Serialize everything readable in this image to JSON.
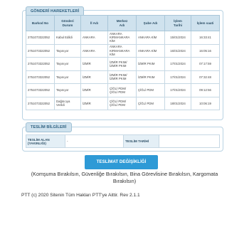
{
  "movements": {
    "title": "GÖNDERİ HAREKETLERİ",
    "headers": [
      "Barkod No",
      "Gönderi\nDurum",
      "İl Adı",
      "Merkez\nAdı",
      "Şube Adı",
      "İşlem\nTarihi",
      "İşlem saati"
    ],
    "rows": [
      [
        "2751073322052",
        "Kabul Edildi",
        "ANKARA",
        "ANKARA KIRMANKARA KİM",
        "ANKARA KİM",
        "15/01/2024",
        "16:33:41"
      ],
      [
        "2751073322052",
        "Taşınıyor",
        "ANKARA",
        "ANKARA KIRMANKARA KİM",
        "ANKARA KİM",
        "16/01/2024",
        "16:05:16"
      ],
      [
        "2751073322052",
        "Taşınıyor",
        "İZMİR",
        "İZMİR PKIM/ İZMİR PKIM",
        "İZMİR PKIM",
        "17/01/2024",
        "07:17:59"
      ],
      [
        "2751073322052",
        "Taşınıyor",
        "İZMİR",
        "İZMİR PKIM/ İZMİR PKIM",
        "İZMİR PKIM",
        "17/01/2024",
        "07:32:48"
      ],
      [
        "2751073322052",
        "Taşınıyor",
        "İZMİR",
        "ÇİĞLİ PDM/ ÇİĞLİ PDM",
        "ÇİĞLİ PDM",
        "17/01/2024",
        "09:12:56"
      ],
      [
        "2751073322052",
        "Dağıtıcıya Verildi",
        "İZMİR",
        "ÇİĞLİ PDM/ ÇİĞLİ PDM",
        "ÇİĞLİ PDM",
        "18/01/2024",
        "10:06:19"
      ]
    ]
  },
  "delivery": {
    "title": "TESLİM BİLGİLERİ",
    "receiver_label": "TESLİM ALAN (YAKINLIĞI)",
    "receiver_value": "-",
    "date_label": "TESLİM TARİHİ",
    "date_value": ""
  },
  "change_button": "TESLİMAT DEĞİŞİKLİĞİ",
  "change_note": "(Komşuma Bırakılsın, Güvenliğe Bırakılsın, Bina Görevlisine Bırakılsın, Kargomata Bırakılsın)",
  "footer": "PTT (c) 2020 Sitenin Tüm Hakları PTT'ye Aittir. Rev 2.1.1"
}
